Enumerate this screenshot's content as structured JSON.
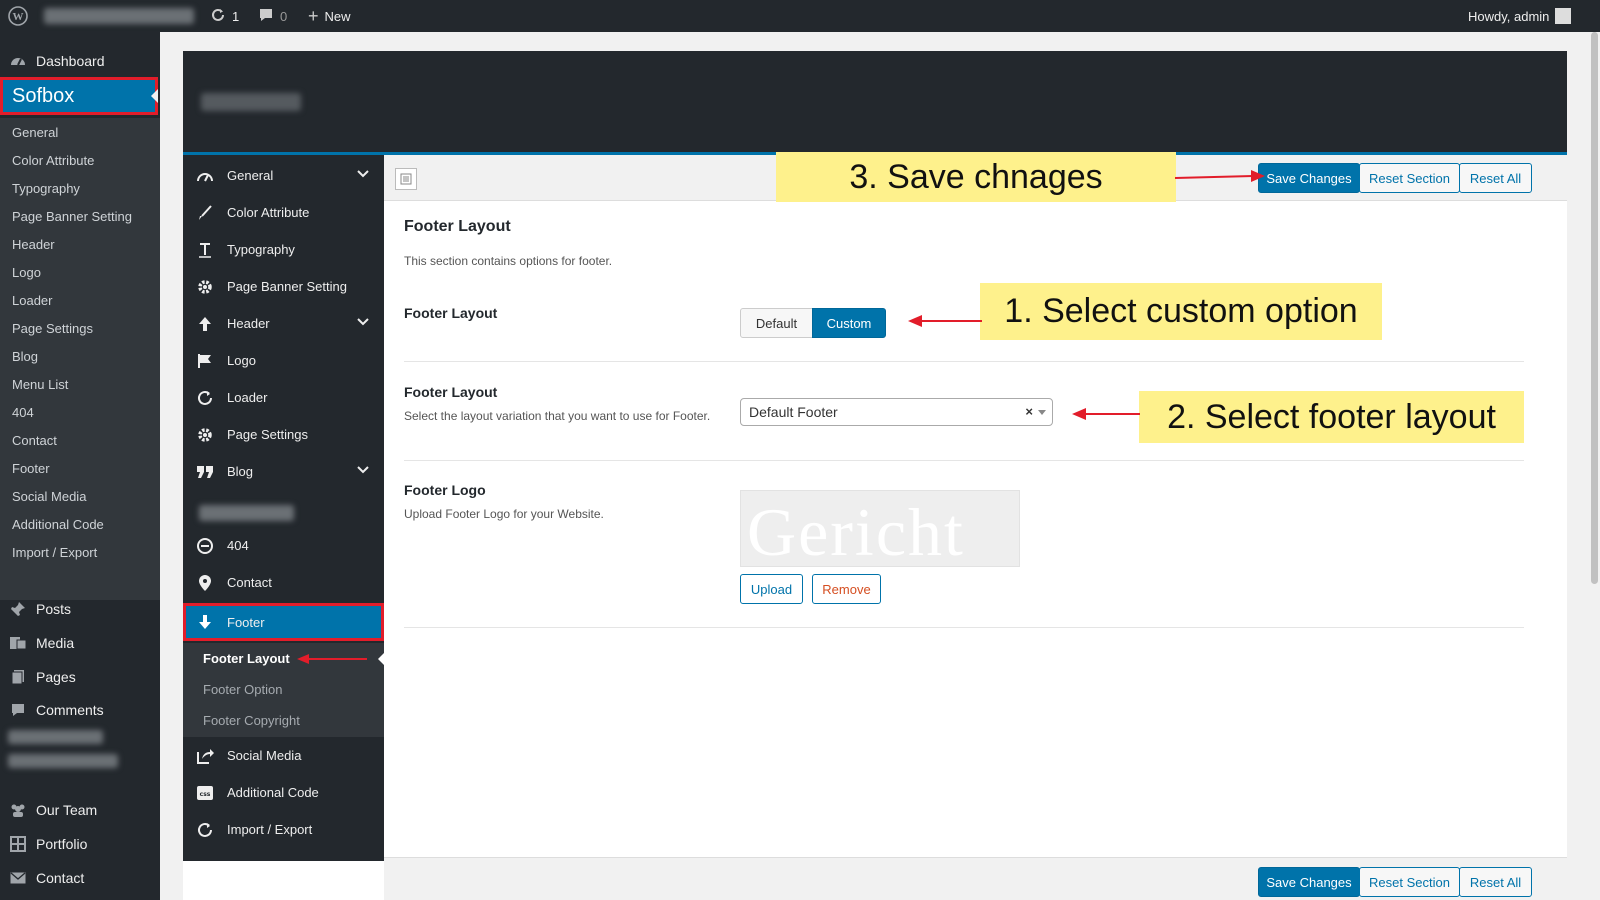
{
  "adminbar": {
    "updates_count": "1",
    "comments_count": "0",
    "new_label": "New",
    "howdy": "Howdy, admin"
  },
  "wp_menu": {
    "dashboard": "Dashboard",
    "sofbox": "Sofbox",
    "sofbox_items": [
      "General",
      "Color Attribute",
      "Typography",
      "Page Banner Setting",
      "Header",
      "Logo",
      "Loader",
      "Page Settings",
      "Blog",
      "Menu List",
      "404",
      "Contact",
      "Footer",
      "Social Media",
      "Additional Code",
      "Import / Export"
    ],
    "posts": "Posts",
    "media": "Media",
    "pages": "Pages",
    "comments": "Comments",
    "our_team": "Our Team",
    "portfolio": "Portfolio",
    "contact": "Contact"
  },
  "panel_nav": {
    "items": [
      "General",
      "Color Attribute",
      "Typography",
      "Page Banner Setting",
      "Header",
      "Logo",
      "Loader",
      "Page Settings",
      "Blog",
      "404",
      "Contact",
      "Footer",
      "Social Media",
      "Additional Code",
      "Import / Export"
    ],
    "footer_sub": [
      "Footer Layout",
      "Footer Option",
      "Footer Copyright"
    ]
  },
  "toolbar": {
    "save": "Save Changes",
    "reset_section": "Reset Section",
    "reset_all": "Reset All"
  },
  "section": {
    "title": "Footer Layout",
    "description": "This section contains options for footer.",
    "layout_label": "Footer Layout",
    "layout_default": "Default",
    "layout_custom": "Custom",
    "variation_label": "Footer Layout",
    "variation_desc": "Select the layout variation that you want to use for Footer.",
    "variation_value": "Default Footer",
    "logo_label": "Footer Logo",
    "logo_desc": "Upload Footer Logo for your Website.",
    "logo_preview_text": "Gericht",
    "upload": "Upload",
    "remove": "Remove"
  },
  "callouts": {
    "save": "3. Save chnages",
    "custom": "1. Select custom option",
    "layout": "2. Select footer layout"
  },
  "colors": {
    "wp_blue": "#0073aa",
    "dark": "#23282d",
    "highlight": "#e21d2a",
    "callout": "#fef18c"
  }
}
